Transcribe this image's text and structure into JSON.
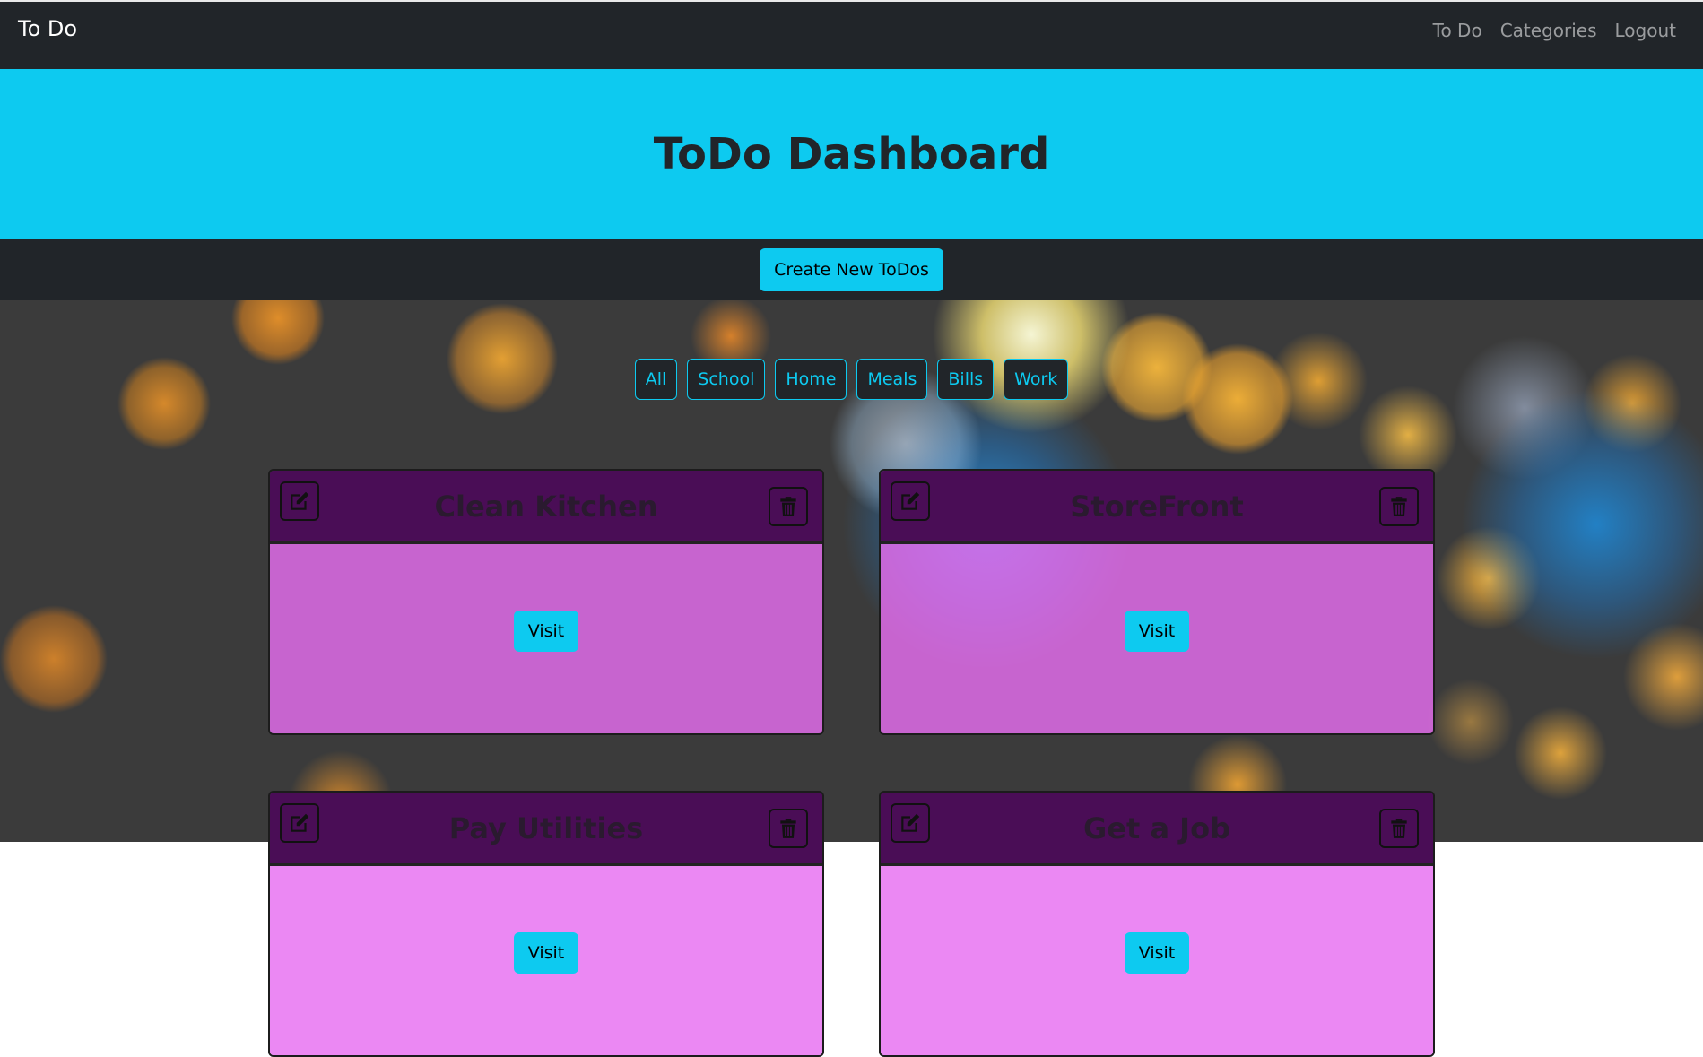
{
  "nav": {
    "brand": "To Do",
    "links": [
      "To Do",
      "Categories",
      "Logout"
    ]
  },
  "hero": {
    "title": "ToDo Dashboard"
  },
  "actions": {
    "create_label": "Create New ToDos"
  },
  "filters": [
    "All",
    "School",
    "Home",
    "Meals",
    "Bills",
    "Work"
  ],
  "todos": [
    {
      "title": "Clean Kitchen",
      "visit_label": "Visit"
    },
    {
      "title": "StoreFront",
      "visit_label": "Visit"
    },
    {
      "title": "Pay Utilities",
      "visit_label": "Visit"
    },
    {
      "title": "Get a Job",
      "visit_label": "Visit"
    }
  ],
  "colors": {
    "navbar": "#212529",
    "accent": "#0dcaf0",
    "card_header": "#4a0d56",
    "card_body": "#e66ef0"
  },
  "icons": {
    "edit": "edit-icon",
    "delete": "trash-icon"
  }
}
